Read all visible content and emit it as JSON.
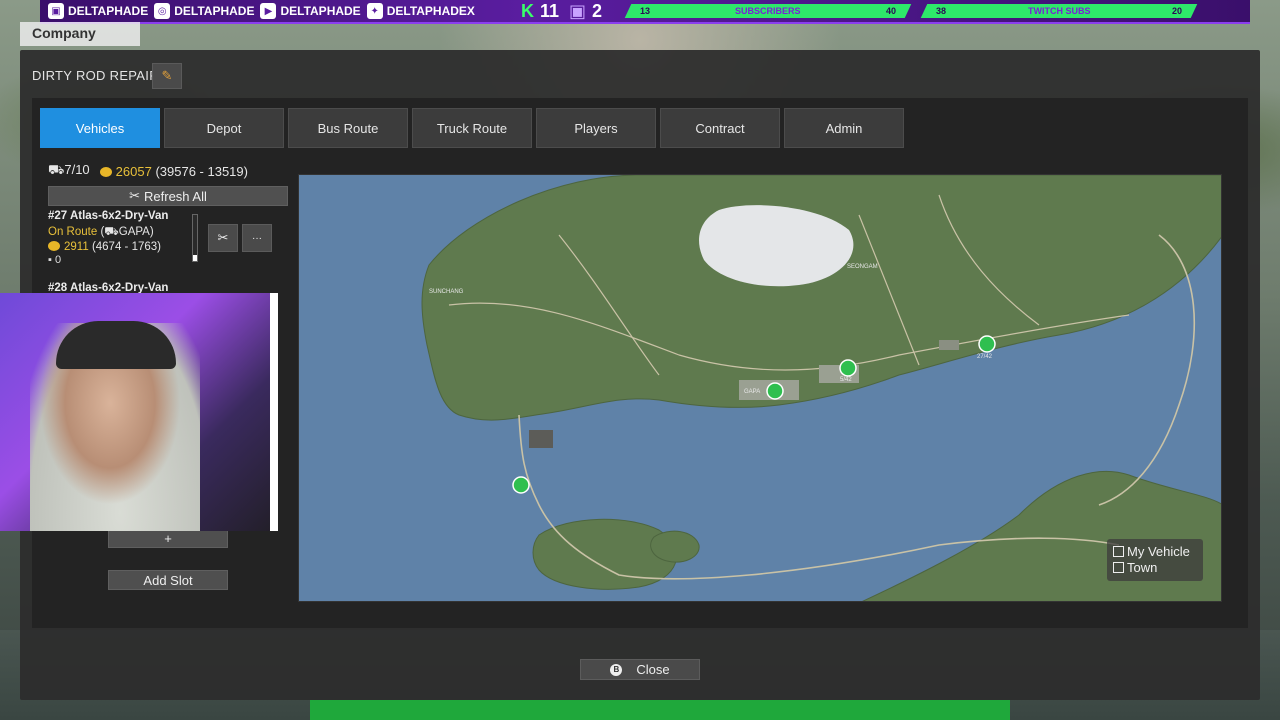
{
  "stream_overlay": {
    "socials": [
      {
        "icon": "twitch-icon",
        "handle": "DELTAPHADE"
      },
      {
        "icon": "instagram-icon",
        "handle": "DELTAPHADE"
      },
      {
        "icon": "youtube-icon",
        "handle": "DELTAPHADE"
      },
      {
        "icon": "twitter-icon",
        "handle": "DELTAPHADEX"
      }
    ],
    "kick_count": "11",
    "twitch_count": "2",
    "goals": [
      {
        "current": "13",
        "label": "SUBSCRIBERS",
        "target": "40"
      },
      {
        "current": "38",
        "label": "TWITCH SUBS",
        "target": "20"
      }
    ]
  },
  "company_label": "Company",
  "window": {
    "title": "DIRTY ROD REPAIR",
    "tabs": [
      "Vehicles",
      "Depot",
      "Bus Route",
      "Truck Route",
      "Players",
      "Contract",
      "Admin"
    ],
    "active_tab": "Vehicles"
  },
  "stats": {
    "vehicle_count": "7/10",
    "money": "26057",
    "money_breakdown": "(39576 - 13519)"
  },
  "refresh_label": "Refresh All",
  "vehicles": [
    {
      "name": "#27 Atlas-6x2-Dry-Van",
      "status": "On Route",
      "route_prefix": "(",
      "route": "GAPA)",
      "money": "2911",
      "money_breakdown": "(4674 - 1763)",
      "cargo": "0",
      "more_label": "···"
    },
    {
      "name": "#28 Atlas-6x2-Dry-Van"
    }
  ],
  "plus_label": "+",
  "add_slot_label": "Add Slot",
  "map": {
    "labels": [
      "SUNCHANG",
      "GAPA",
      "SEONGAM",
      "5/42",
      "27/42"
    ],
    "legend": [
      "My Vehicle",
      "Town"
    ]
  },
  "close_label": "Close",
  "close_key": "B"
}
